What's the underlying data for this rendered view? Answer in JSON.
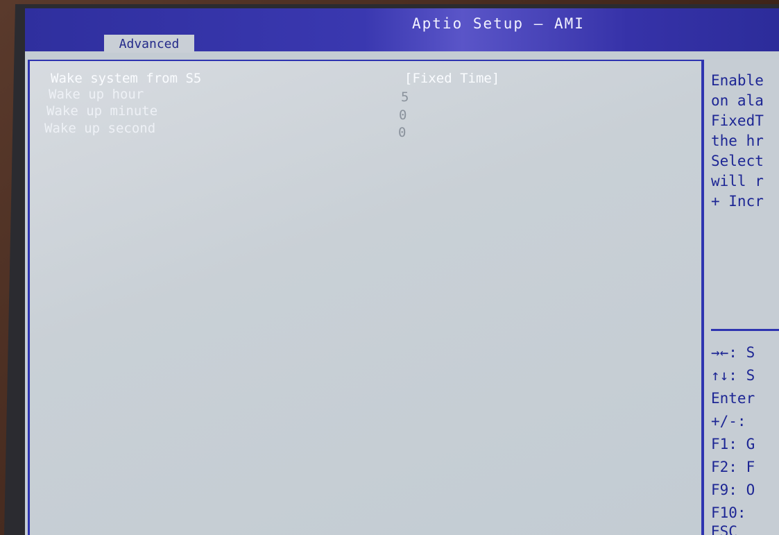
{
  "header": {
    "title": "Aptio Setup – AMI",
    "active_tab": "Advanced"
  },
  "settings": [
    {
      "label": "Wake system from S5",
      "value": "[Fixed Time]"
    },
    {
      "label": "Wake up hour",
      "value": "5"
    },
    {
      "label": "Wake up minute",
      "value": "0"
    },
    {
      "label": "Wake up second",
      "value": "0"
    }
  ],
  "help_panel": {
    "lines": [
      "Enable",
      "on ala",
      "FixedT",
      "the hr",
      "Select",
      "will r",
      "+ Incr"
    ]
  },
  "key_legend": {
    "lines": [
      "→←: S",
      "↑↓: S",
      "Enter",
      "+/-:",
      "F1: G",
      "F2: F",
      "F9: O",
      "F10:",
      "ESC"
    ]
  },
  "colors": {
    "header_blue": "#3a38b0",
    "border_blue": "#2e34b0",
    "panel_gray": "#c4ccd3",
    "help_text": "#1d2694"
  }
}
